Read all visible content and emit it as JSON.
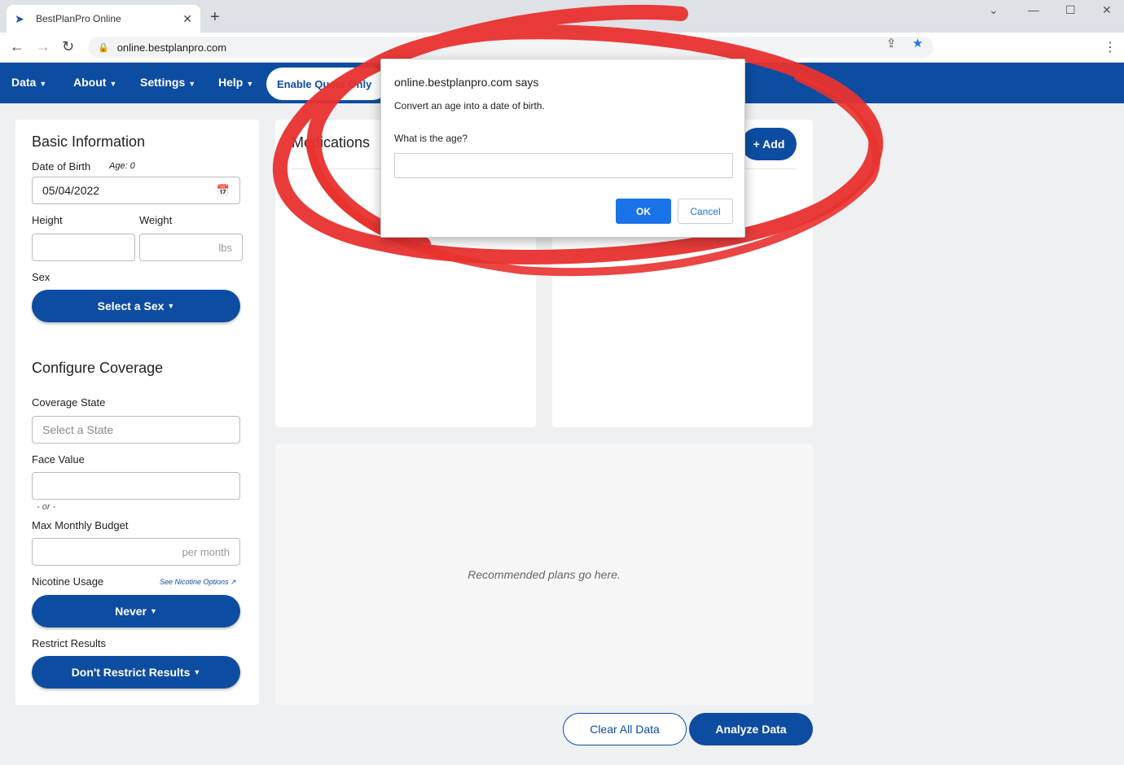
{
  "browser": {
    "tab_title": "BestPlanPro Online",
    "url": "online.bestplanpro.com"
  },
  "nav": {
    "items": [
      "Data",
      "About",
      "Settings",
      "Help"
    ],
    "enable_button": "Enable Quote Only"
  },
  "basic_info": {
    "title": "Basic Information",
    "dob_label": "Date of Birth",
    "age_label": "Age: 0",
    "dob_value": "05/04/2022",
    "height_label": "Height",
    "weight_label": "Weight",
    "weight_unit": "lbs",
    "sex_label": "Sex",
    "sex_button": "Select a Sex"
  },
  "coverage": {
    "title": "Configure Coverage",
    "state_label": "Coverage State",
    "state_placeholder": "Select a State",
    "face_label": "Face Value",
    "or_text": "- or -",
    "budget_label": "Max Monthly Budget",
    "budget_unit": "per month",
    "nicotine_label": "Nicotine Usage",
    "nicotine_link": "See Nicotine Options",
    "nicotine_button": "Never",
    "restrict_label": "Restrict Results",
    "restrict_button": "Don't Restrict Results"
  },
  "medications": {
    "title": "Medications",
    "add_button": "+ Add"
  },
  "recommended": {
    "placeholder": "Recommended plans go here."
  },
  "actions": {
    "clear": "Clear All Data",
    "analyze": "Analyze Data"
  },
  "dialog": {
    "title": "online.bestplanpro.com says",
    "message": "Convert an age into a date of birth.",
    "question": "What is the age?",
    "ok": "OK",
    "cancel": "Cancel"
  },
  "colors": {
    "brand_blue": "#0d4da1",
    "annotation_red": "#e8322f",
    "dialog_blue": "#1a73e8"
  }
}
